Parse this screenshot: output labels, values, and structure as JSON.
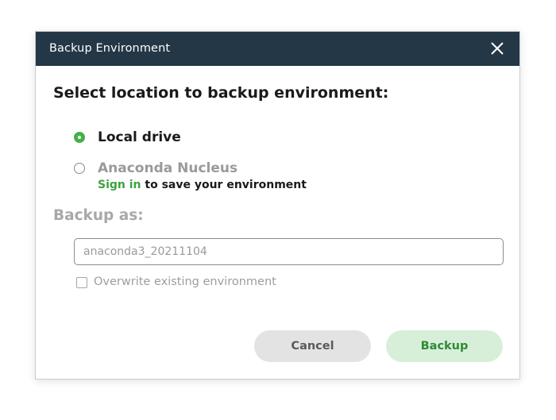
{
  "dialog": {
    "title": "Backup Environment",
    "close_icon": "close-icon",
    "heading": "Select location to backup environment:",
    "location_options": [
      {
        "label": "Local drive",
        "selected": true
      },
      {
        "label": "Anaconda Nucleus",
        "selected": false
      }
    ],
    "signin": {
      "link_text": "Sign in",
      "rest_text": " to save your environment"
    },
    "backup_as_label": "Backup as:",
    "backup_name_value": "anaconda3_20211104",
    "overwrite_label": "Overwrite existing environment",
    "overwrite_checked": false,
    "cancel_label": "Cancel",
    "backup_label": "Backup"
  },
  "colors": {
    "titlebar": "#243746",
    "accent_green": "#43b049",
    "link_green": "#3ba33f",
    "backup_button_bg": "#d7efd9",
    "cancel_button_bg": "#e3e3e3"
  }
}
